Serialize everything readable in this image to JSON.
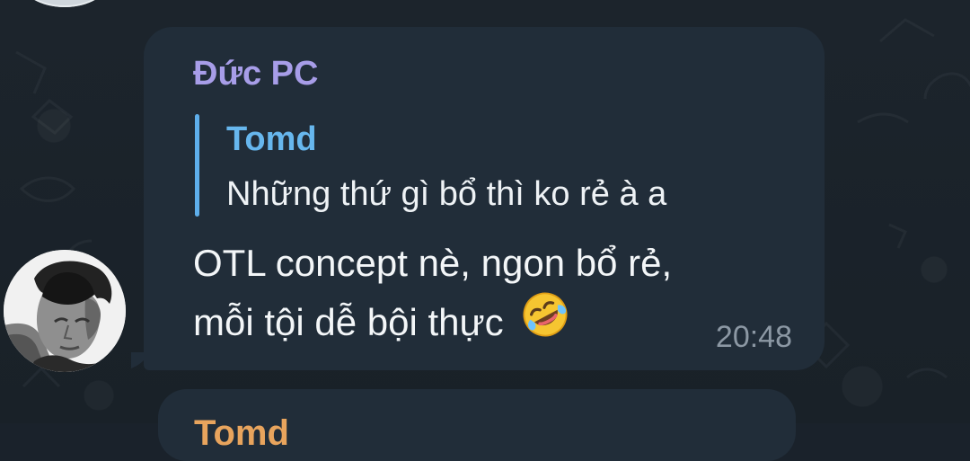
{
  "chat": {
    "message": {
      "sender": "Đức PC",
      "reply": {
        "author": "Tomd",
        "text": "Những thứ gì bổ thì ko rẻ à a"
      },
      "text_lines": [
        "OTL concept nè, ngon bổ rẻ,",
        "mỗi tội dễ bội thực"
      ],
      "emoji": "rolling-on-the-floor-laughing-emoji",
      "time": "20:48"
    },
    "next_message": {
      "sender": "Tomd"
    }
  },
  "colors": {
    "background": "#1a222b",
    "bubble": "#212d39",
    "sender": "#a79de8",
    "reply_accent": "#5eaeeb",
    "next_sender": "#e8a45d",
    "timestamp": "#8c98a4"
  },
  "icons": {
    "emoji": "rolling-on-the-floor-laughing-emoji"
  }
}
